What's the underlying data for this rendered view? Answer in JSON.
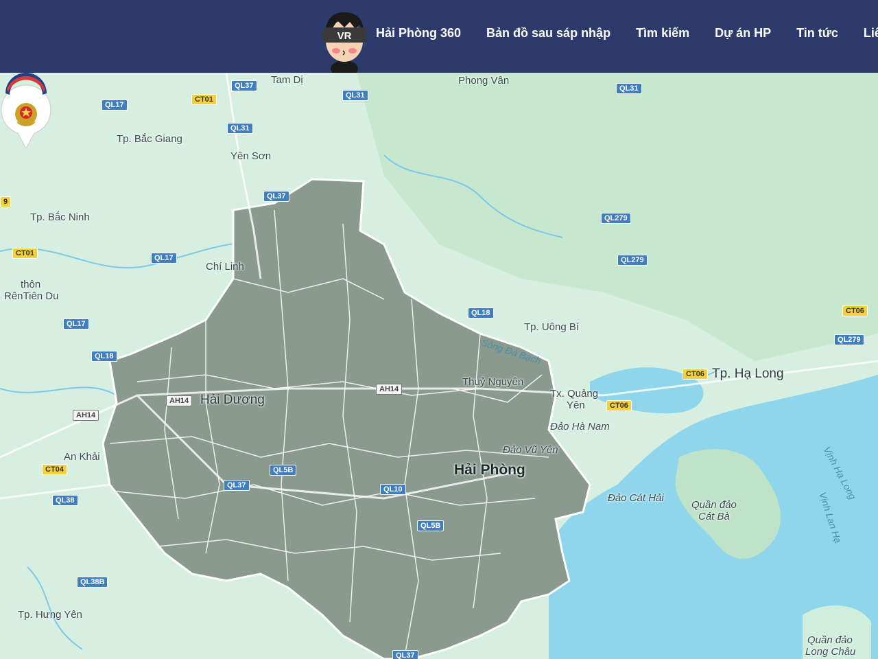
{
  "header": {
    "logo_text": "VR",
    "nav": [
      {
        "label": "Hải Phòng 360"
      },
      {
        "label": "Bản đồ sau sáp nhập"
      },
      {
        "label": "Tìm kiếm"
      },
      {
        "label": "Dự án HP"
      },
      {
        "label": "Tin tức"
      },
      {
        "label": "Liên"
      }
    ]
  },
  "map": {
    "places": [
      {
        "name": "Tam Dị"
      },
      {
        "name": "Phong Vân"
      },
      {
        "name": "Tp. Bắc Giang"
      },
      {
        "name": "Yên Sơn"
      },
      {
        "name": "Tp. Bắc Ninh"
      },
      {
        "name": "Chí Linh"
      },
      {
        "name": "thôn"
      },
      {
        "name": "RênTiên Du"
      },
      {
        "name": "Tp. Uông Bí"
      },
      {
        "name": "Tp. Hạ Long"
      },
      {
        "name": "Thuỷ Nguyên"
      },
      {
        "name": "Hải Dương"
      },
      {
        "name": "Tx. Quảng"
      },
      {
        "name": "Yên"
      },
      {
        "name": "Đảo Hà Nam"
      },
      {
        "name": "Đảo Vũ Yên"
      },
      {
        "name": "Hải Phòng"
      },
      {
        "name": "An Khải"
      },
      {
        "name": "Đảo Cát Hải"
      },
      {
        "name": "Quần đảo"
      },
      {
        "name": "Cát Bà"
      },
      {
        "name": "Tp. Hưng Yên"
      },
      {
        "name": "Quần đảo"
      },
      {
        "name": "Long Châu"
      },
      {
        "name": "Sông Đá Bạch"
      }
    ],
    "water_labels": [
      {
        "name": "Vịnh Hạ Long"
      },
      {
        "name": "Vịnh Lan Hạ"
      }
    ],
    "road_shields": [
      {
        "label": "QL37"
      },
      {
        "label": "QL31"
      },
      {
        "label": "QL17"
      },
      {
        "label": "CT01"
      },
      {
        "label": "QL31"
      },
      {
        "label": "QL31"
      },
      {
        "label": "QL37"
      },
      {
        "label": "QL279"
      },
      {
        "label": "CT01"
      },
      {
        "label": "QL17"
      },
      {
        "label": "QL279"
      },
      {
        "label": "QL17"
      },
      {
        "label": "QL18"
      },
      {
        "label": "CT06"
      },
      {
        "label": "QL279"
      },
      {
        "label": "QL18"
      },
      {
        "label": "CT06"
      },
      {
        "label": "CT06"
      },
      {
        "label": "AH14"
      },
      {
        "label": "AH14"
      },
      {
        "label": "AH14"
      },
      {
        "label": "CT04"
      },
      {
        "label": "QL38"
      },
      {
        "label": "QL5B"
      },
      {
        "label": "QL37"
      },
      {
        "label": "QL10"
      },
      {
        "label": "QL5B"
      },
      {
        "label": "QL38B"
      },
      {
        "label": "QL37"
      },
      {
        "label": "9"
      }
    ],
    "colors": {
      "land": "#d9f0e3",
      "sea": "#8fd6ec",
      "region": "#8a9a8f",
      "header": "#2c3b6b"
    }
  }
}
